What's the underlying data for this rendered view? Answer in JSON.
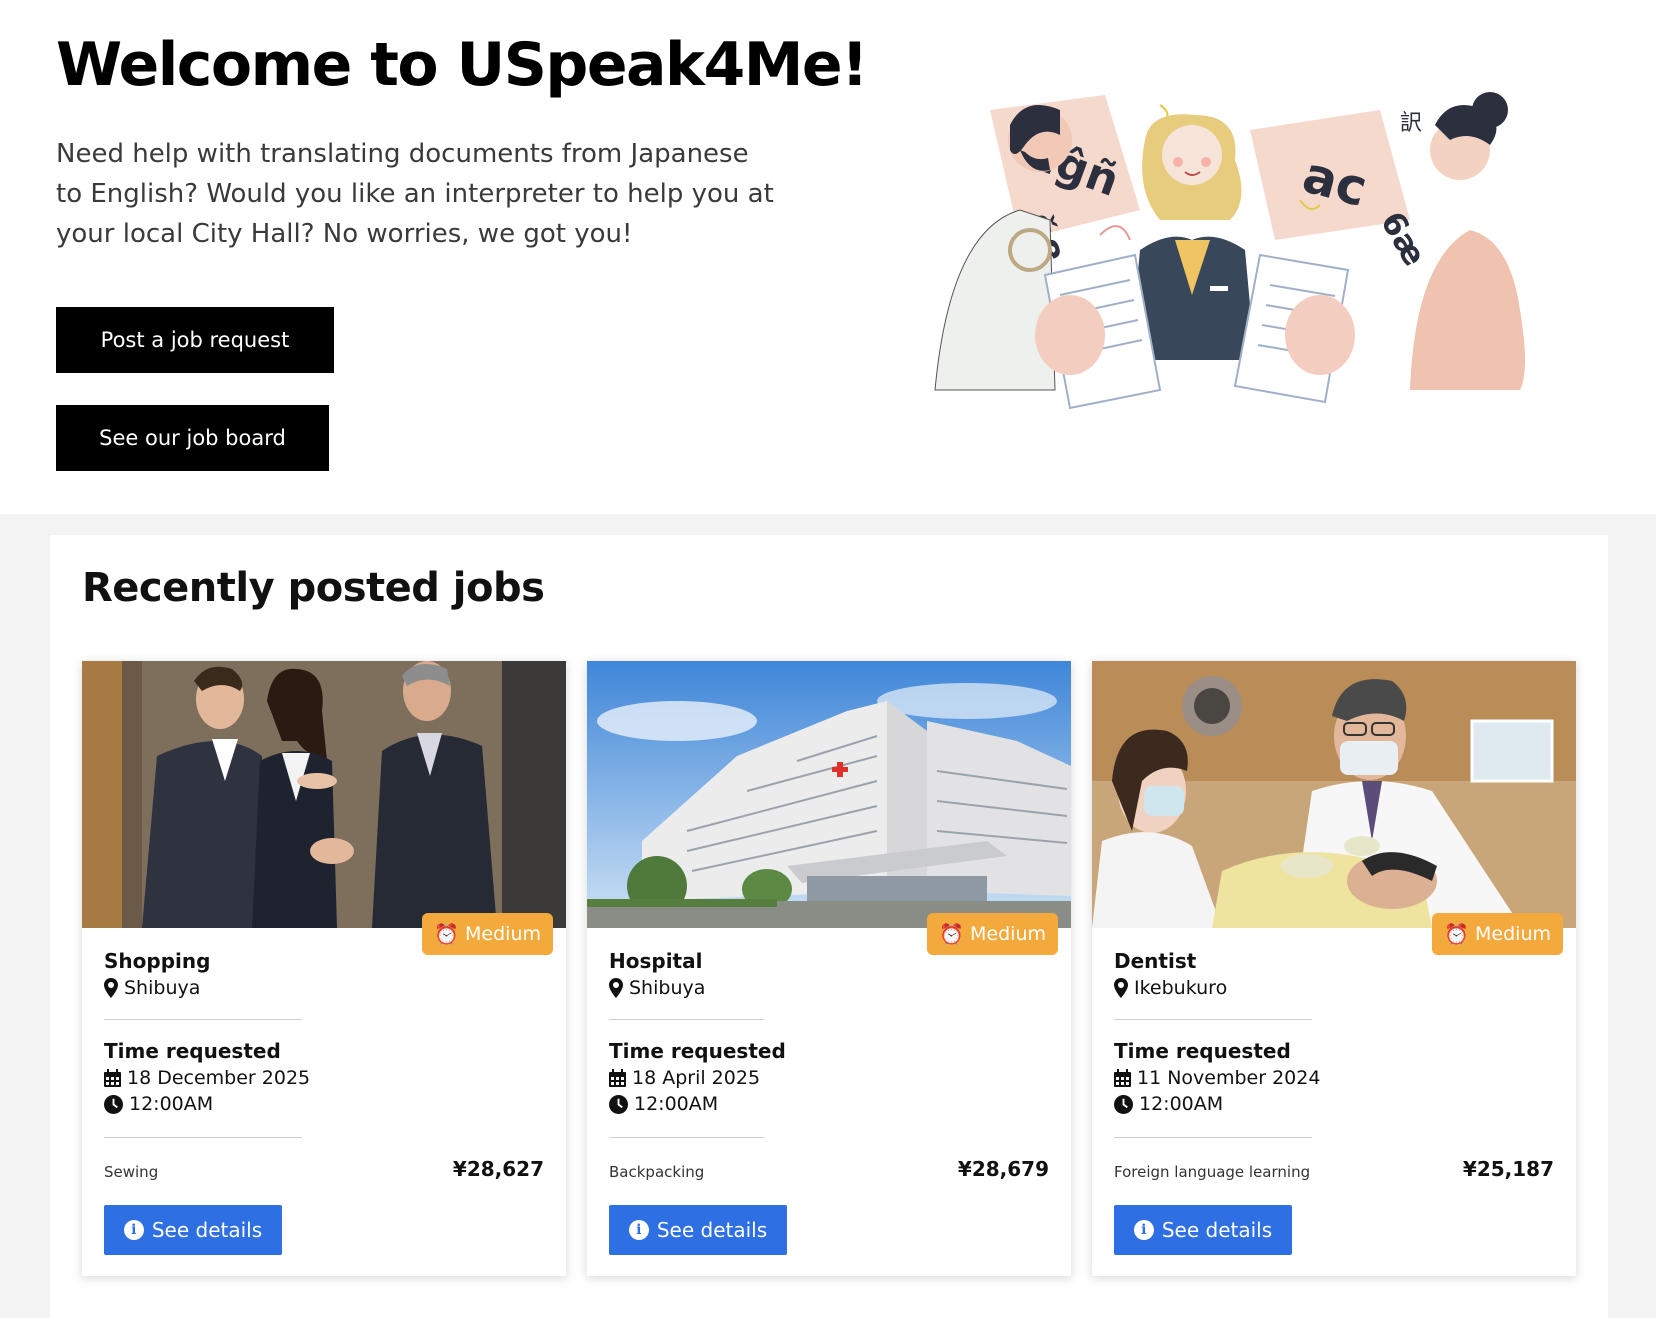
{
  "hero": {
    "title": "Welcome to USpeak4Me!",
    "lead": "Need help with translating documents from Japanese to English? Would you like an interpreter to help you at your local City Hall? No worries, we got you!",
    "post_button": "Post a job request",
    "board_button": "See our job board"
  },
  "jobs": {
    "title": "Recently posted jobs",
    "time_label": "Time requested",
    "details_label": "See details",
    "cards": [
      {
        "badge": "Medium",
        "category": "Shopping",
        "location": "Shibuya",
        "date": "18 December 2025",
        "time": "12:00AM",
        "hobby": "Sewing",
        "price": "¥28,627",
        "image": "business-handshake-photo"
      },
      {
        "badge": "Medium",
        "category": "Hospital",
        "location": "Shibuya",
        "date": "18 April 2025",
        "time": "12:00AM",
        "hobby": "Backpacking",
        "price": "¥28,679",
        "image": "hospital-building-photo"
      },
      {
        "badge": "Medium",
        "category": "Dentist",
        "location": "Ikebukuro",
        "date": "11 November 2024",
        "time": "12:00AM",
        "hobby": "Foreign language learning",
        "price": "¥25,187",
        "image": "dentist-photo"
      }
    ]
  },
  "colors": {
    "badge": "#f3a93c",
    "primary_button": "#2f6fe4",
    "hero_button": "#000000"
  }
}
